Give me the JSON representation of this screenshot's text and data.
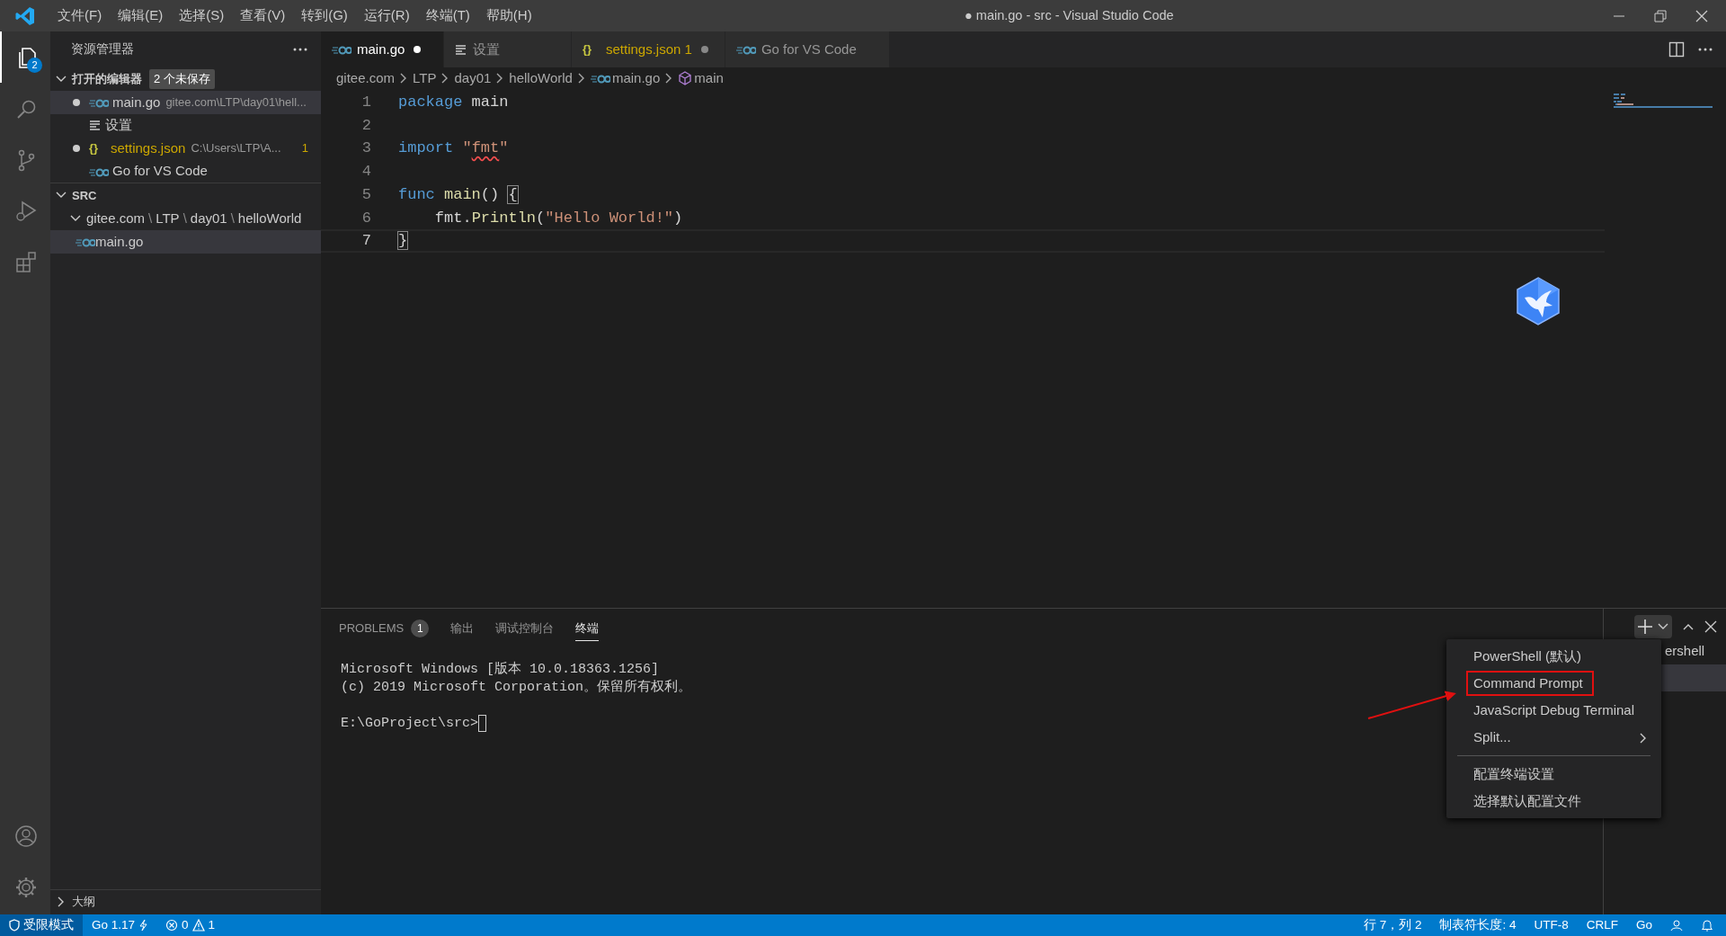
{
  "window": {
    "title": "● main.go - src - Visual Studio Code"
  },
  "menu": [
    "文件(F)",
    "编辑(E)",
    "选择(S)",
    "查看(V)",
    "转到(G)",
    "运行(R)",
    "终端(T)",
    "帮助(H)"
  ],
  "activity_bar": {
    "items": [
      {
        "kind": "explorer",
        "selected": true,
        "badge": "2"
      },
      {
        "kind": "search",
        "selected": false
      },
      {
        "kind": "source-control",
        "selected": false
      },
      {
        "kind": "run",
        "selected": false
      },
      {
        "kind": "extensions",
        "selected": false
      }
    ]
  },
  "sidebar": {
    "title": "资源管理器",
    "open_editors": {
      "title": "打开的编辑器",
      "expanded": true,
      "badge": "2 个未保存",
      "items": [
        {
          "kind": "go",
          "name": "main.go",
          "path": "gitee.com\\LTP\\day01\\hell...",
          "dirty": true,
          "selected": true
        },
        {
          "kind": "settings",
          "name": "设置",
          "dirty": false,
          "selected": false
        },
        {
          "kind": "json",
          "icon_glyph": "{}",
          "name": "settings.json",
          "path": "C:\\Users\\LTP\\A...",
          "problems": "1",
          "dirty": true,
          "selected": false
        },
        {
          "kind": "go",
          "name": "Go for VS Code",
          "dirty": false,
          "selected": false
        }
      ]
    },
    "folder": {
      "title": "SRC",
      "expanded": true,
      "children": [
        {
          "segments": [
            "gitee.com",
            "LTP",
            "day01",
            "helloWorld"
          ],
          "separator": "\\",
          "expanded": true,
          "selected": false,
          "children": [
            {
              "name": "main.go",
              "kind": "go",
              "selected": true
            }
          ]
        }
      ]
    },
    "outline": {
      "title": "大纲",
      "expanded": false
    }
  },
  "tabs": [
    {
      "label": "main.go",
      "kind": "go",
      "selected": true,
      "dirty": true
    },
    {
      "label": "设置",
      "kind": "settings",
      "selected": false,
      "dirty": false
    },
    {
      "label": "settings.json",
      "kind": "json",
      "icon_glyph": "{}",
      "problems": "1",
      "selected": false,
      "dirty": true
    },
    {
      "label": "Go for VS Code",
      "kind": "go",
      "selected": false,
      "dirty": false
    }
  ],
  "breadcrumb": [
    {
      "label": "gitee.com",
      "kind": "folder"
    },
    {
      "label": "LTP",
      "kind": "folder"
    },
    {
      "label": "day01",
      "kind": "folder"
    },
    {
      "label": "helloWorld",
      "kind": "folder"
    },
    {
      "label": "main.go",
      "kind": "go"
    },
    {
      "label": "main",
      "kind": "symbol"
    }
  ],
  "code": {
    "lines": [
      {
        "number": "1",
        "current": false,
        "tokens": [
          {
            "text": "package",
            "kind": "keyword"
          },
          {
            "text": " main",
            "kind": "plain"
          }
        ]
      },
      {
        "number": "2",
        "current": false
      },
      {
        "number": "3",
        "current": false,
        "tokens": [
          {
            "text": "import ",
            "kind": "keyword"
          },
          {
            "text": "\"",
            "kind": "string"
          },
          {
            "text": "fmt",
            "kind": "string-warning"
          },
          {
            "text": "\"",
            "kind": "string"
          }
        ]
      },
      {
        "number": "4",
        "current": false
      },
      {
        "number": "5",
        "current": false,
        "tokens": [
          {
            "text": "func ",
            "kind": "keyword"
          },
          {
            "text": "main",
            "kind": "function"
          },
          {
            "text": "() ",
            "kind": "plain"
          },
          {
            "text": "{",
            "kind": "bracket-match"
          }
        ]
      },
      {
        "number": "6",
        "current": false,
        "tokens": [
          {
            "text": "    fmt.",
            "kind": "plain"
          },
          {
            "text": "Println",
            "kind": "function"
          },
          {
            "text": "(",
            "kind": "plain"
          },
          {
            "text": "\"Hello World!\"",
            "kind": "string"
          },
          {
            "text": ")",
            "kind": "plain"
          }
        ]
      },
      {
        "number": "7",
        "current": true,
        "tokens": [
          {
            "text": "}",
            "kind": "bracket-match"
          }
        ]
      }
    ]
  },
  "panel": {
    "tabs": [
      {
        "label": "PROBLEMS",
        "badge": "1",
        "selected": false
      },
      {
        "label": "输出",
        "selected": false
      },
      {
        "label": "调试控制台",
        "selected": false
      },
      {
        "label": "终端",
        "selected": true
      }
    ],
    "terminal": {
      "lines": [
        "Microsoft Windows [版本 10.0.18363.1256]",
        "(c) 2019 Microsoft Corporation。保留所有权利。"
      ],
      "prompt": "E:\\GoProject\\src>"
    },
    "terminal_list": [
      {
        "label": "ershell",
        "selected": false
      },
      {
        "selected": true
      }
    ]
  },
  "dropdown": {
    "items": [
      {
        "kind": "item",
        "label": "PowerShell (默认)",
        "annotated": false
      },
      {
        "kind": "item",
        "label": "Command Prompt",
        "annotated": true
      },
      {
        "kind": "item",
        "label": "JavaScript Debug Terminal",
        "annotated": false
      },
      {
        "kind": "submenu",
        "label": "Split...",
        "annotated": false
      },
      {
        "kind": "separator"
      },
      {
        "kind": "item",
        "label": "配置终端设置",
        "annotated": false
      },
      {
        "kind": "item",
        "label": "选择默认配置文件",
        "annotated": false
      }
    ]
  },
  "status_bar": {
    "left": [
      {
        "kind": "restricted",
        "label": "受限模式"
      },
      {
        "kind": "go-version",
        "label": "Go 1.17"
      },
      {
        "kind": "problems",
        "errors": "0",
        "warnings": "1"
      }
    ],
    "right": [
      "行 7，列 2",
      "制表符长度: 4",
      "UTF-8",
      "CRLF",
      "Go"
    ]
  }
}
